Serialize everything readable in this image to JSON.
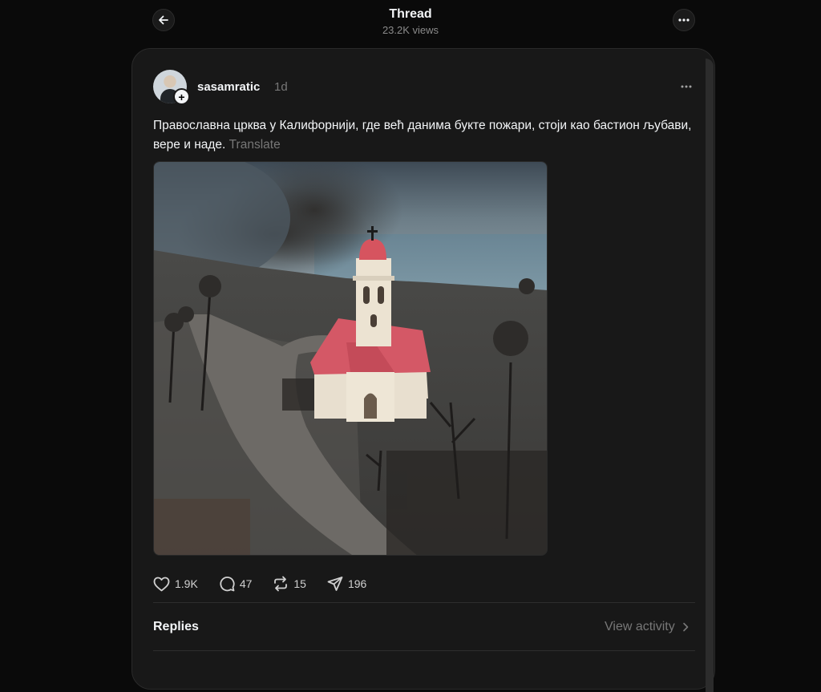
{
  "header": {
    "title": "Thread",
    "views": "23.2K views"
  },
  "post": {
    "username": "sasamratic",
    "time": "1d",
    "text": "Православна црква у Калифорнији, где већ данима букте пожари, стоји као бастион љубави, вере и наде.",
    "translate_label": "Translate",
    "image_alt": "Orthodox church with red roof standing among burned landscape",
    "stats": {
      "likes": "1.9K",
      "comments": "47",
      "reposts": "15",
      "shares": "196"
    }
  },
  "replies": {
    "label": "Replies",
    "view_activity": "View activity"
  },
  "colors": {
    "background": "#0a0a0a",
    "card": "#181818",
    "text": "#f3f5f7",
    "muted": "#777777"
  },
  "icons": [
    "back-arrow-icon",
    "more-icon",
    "plus-icon",
    "heart-icon",
    "comment-icon",
    "repost-icon",
    "share-icon",
    "chevron-right-icon"
  ]
}
